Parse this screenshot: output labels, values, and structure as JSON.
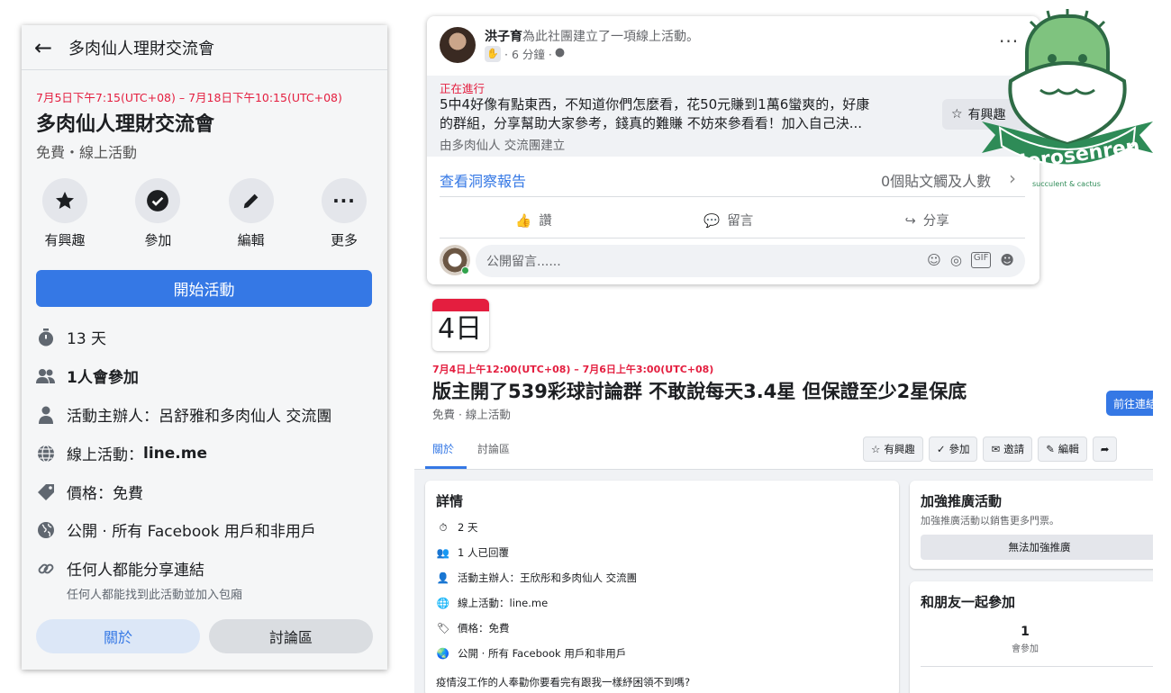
{
  "left_panel": {
    "header_title": "多肉仙人理財交流會",
    "date": "7月5日下午7:15(UTC+08) – 7月18日下午10:15(UTC+08)",
    "title": "多肉仙人理財交流會",
    "subtitle": "免費・線上活動",
    "actions": [
      {
        "label": "有興趣",
        "icon": "star-icon"
      },
      {
        "label": "參加",
        "icon": "check-circle-icon"
      },
      {
        "label": "編輯",
        "icon": "pencil-icon"
      },
      {
        "label": "更多",
        "icon": "more-icon"
      }
    ],
    "start_button": "開始活動",
    "info": {
      "duration": "13 天",
      "attending": "1人會參加",
      "host": "活動主辦人：呂舒雅和多肉仙人 交流團",
      "online_label": "線上活動：",
      "online_value": "line.me",
      "price": "價格：免費",
      "privacy": "公開 · 所有 Facebook 用戶和非用戶",
      "share": "任何人都能分享連結",
      "share_sub": "任何人都能找到此活動並加入包廂"
    },
    "tabs": [
      "關於",
      "討論區"
    ]
  },
  "post": {
    "author": "洪子育",
    "action_text": "為此社團建立了一項線上活動。",
    "time": "· 6 分鐘 ·",
    "live_label": "正在進行",
    "text_line1": "5中4好像有點東西，不知道你們怎麼看，花50元賺到1萬6蠻爽的，好康",
    "text_line2": "的群組，分享幫助大家參考，錢真的難賺 不妨來參看看！加入自己決...",
    "group": "由多肉仙人 交流團建立",
    "interest_button": "有興趣",
    "insight_link": "查看洞察報告",
    "reach": "0個貼文觸及人數",
    "reactions": [
      "讚",
      "留言",
      "分享"
    ],
    "comment_placeholder": "公開留言......"
  },
  "logo": {
    "name": "dorosenren",
    "tagline": "succulent & cactus"
  },
  "event": {
    "calendar_day": "4日",
    "date": "7月4日上午12:00(UTC+08) – 7月6日上午3:00(UTC+08)",
    "title": "版主開了539彩球討論群 不敢說每天3.4星 但保證至少2星保底",
    "subtitle": "免費 · 線上活動",
    "goto_button": "前往連結",
    "tabs": [
      "關於",
      "討論區"
    ],
    "actions": [
      "有興趣",
      "參加",
      "邀請",
      "編輯"
    ],
    "details": {
      "heading": "詳情",
      "duration": "2 天",
      "replied": "1 人已回覆",
      "host": "活動主辦人：王欣彤和多肉仙人 交流團",
      "online": "線上活動：line.me",
      "price": "價格：免費",
      "privacy": "公開 · 所有 Facebook 用戶和非用戶",
      "description": "疫情沒工作的人奉勸你要看完有跟我一樣紓困領不到嗎?"
    },
    "boost": {
      "heading": "加強推廣活動",
      "sub": "加強推廣活動以銷售更多門票。",
      "button": "無法加強推廣"
    },
    "friends": {
      "heading": "和朋友一起參加",
      "count": "1",
      "caption": "會參加"
    }
  },
  "colors": {
    "facebook_blue": "#3578e5",
    "live_red": "#e41e3f",
    "logo_green": "#2e8b57"
  }
}
